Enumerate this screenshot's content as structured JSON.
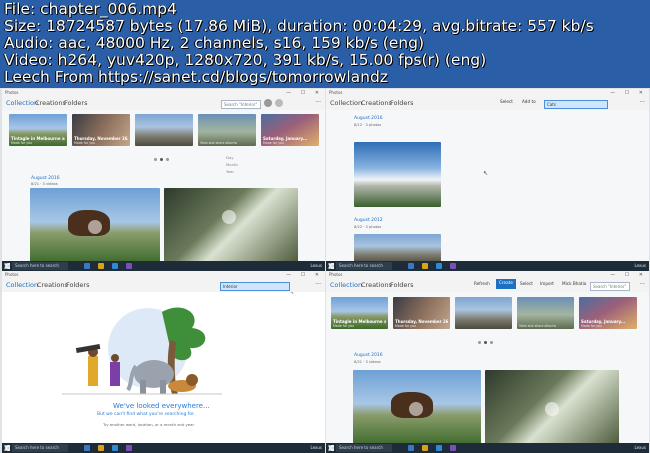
{
  "info": {
    "line1": "File: chapter_006.mp4",
    "line2": "Size: 18724587 bytes (17.86 MiB), duration: 00:04:29, avg.bitrate: 557 kb/s",
    "line3": "Audio: aac, 48000 Hz, 2 channels, s16, 159 kb/s (eng)",
    "line4": "Video: h264, yuv420p, 1280x720, 391 kb/s, 15.00 fps(r) (eng)",
    "line5": "Leech From https://sanet.cd/blogs/tomorrowlandz"
  },
  "app": {
    "title": "Photos",
    "nav": {
      "collection": "Collection",
      "creations": "Creations",
      "folders": "Folders"
    },
    "search_placeholder": "Search \"Interior\"",
    "taskbar_search": "Search here to search",
    "watermark": "Lexus"
  },
  "pane1": {
    "tiles": [
      {
        "caption": "Tintagle in Melbourne and Lorne",
        "sub": "Made for you"
      },
      {
        "caption": "Thursday, November 26, 2009",
        "sub": "Made for you"
      },
      {
        "caption": "",
        "sub": ""
      },
      {
        "caption": "",
        "sub": "View and share albums"
      },
      {
        "caption": "Saturday, January...",
        "sub": "Made for you"
      }
    ],
    "ghost_items": [
      "Day",
      "Month",
      "Year"
    ],
    "date_head": "August 2016",
    "date_sub": "8/21 · 3 videos"
  },
  "pane2": {
    "toolbar": {
      "select": "Select",
      "add_to": "Add to"
    },
    "search_value": "Cats",
    "date_head": "August 2016",
    "date_sub": "8/12 · 3 photos",
    "date_head2": "August 2012",
    "date_sub2": "8/22 · 3 photos"
  },
  "pane3": {
    "search_value": "Interior",
    "msg1": "We've looked everywhere...",
    "msg2": "But we can't find what you're searching for.",
    "msg3": "Try another word, location, or a month and year"
  },
  "pane4": {
    "toolbar": {
      "refresh": "Refresh",
      "create": "Create",
      "select": "Select",
      "import": "Import",
      "profile": "Mick Bhatia"
    },
    "tiles": [
      {
        "caption": "Tintagle in Melbourne and Lorne",
        "sub": "Made for you"
      },
      {
        "caption": "Thursday, November 26, 2009",
        "sub": "Made for you"
      },
      {
        "caption": "",
        "sub": ""
      },
      {
        "caption": "",
        "sub": "View and share albums"
      },
      {
        "caption": "Saturday, January...",
        "sub": "Made for you"
      }
    ],
    "date_head": "August 2016",
    "date_sub": "8/21 · 3 videos"
  }
}
